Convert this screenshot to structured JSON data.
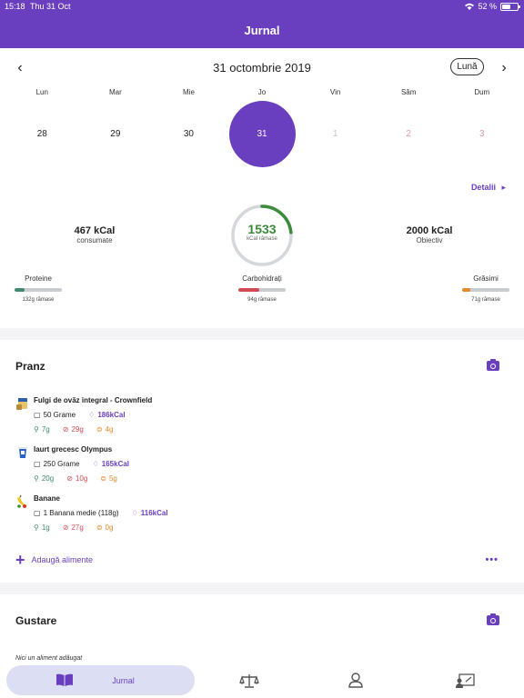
{
  "status_bar": {
    "time": "15:18",
    "date": "Thu 31 Oct",
    "battery": "52 %"
  },
  "header": {
    "title": "Jurnal"
  },
  "calendar": {
    "month_title": "31 octombrie 2019",
    "view_toggle": "Lună",
    "weekdays": [
      "Lun",
      "Mar",
      "Mie",
      "Jo",
      "Vin",
      "Sâm",
      "Dum"
    ],
    "days": [
      "28",
      "29",
      "30",
      "31",
      "1",
      "2",
      "3"
    ],
    "details_link": "Detalii"
  },
  "summary": {
    "consumed_value": "467 kCal",
    "consumed_label": "consumate",
    "remaining_value": "1533",
    "remaining_label": "kCal rămase",
    "goal_value": "2000 kCal",
    "goal_label": "Obiectiv",
    "remaining_fraction_consumed": 0.2335,
    "macros": [
      {
        "name": "Proteine",
        "remaining": "132g rămase",
        "fill": 0.22,
        "color": "#3d8a6e"
      },
      {
        "name": "Carbohidrați",
        "remaining": "94g rămase",
        "fill": 0.45,
        "color": "#d34a55"
      },
      {
        "name": "Grăsimi",
        "remaining": "71g rămase",
        "fill": 0.18,
        "color": "#e48a2b"
      }
    ]
  },
  "meals": {
    "lunch": {
      "title": "Pranz",
      "foods": [
        {
          "name": "Fulgi de ovăz integral - Crownfield",
          "amount": "50 Grame",
          "kcal": "186kCal",
          "protein": "7g",
          "carbs": "29g",
          "fat": "4g"
        },
        {
          "name": "Iaurt grecesc Olympus",
          "amount": "250 Grame",
          "kcal": "165kCal",
          "protein": "20g",
          "carbs": "10g",
          "fat": "5g"
        },
        {
          "name": "Banane",
          "amount": "1 Banana medie (118g)",
          "kcal": "116kCal",
          "protein": "1g",
          "carbs": "27g",
          "fat": "0g"
        }
      ],
      "add_label": "Adaugă alimente",
      "more_label": "•••"
    },
    "snack": {
      "title": "Gustare",
      "empty_text": "Nici un aliment adăugat"
    }
  },
  "tabbar": {
    "active_label": "Jurnal"
  },
  "colors": {
    "accent": "#6a3fbf",
    "ring_green": "#3b8b3b"
  }
}
